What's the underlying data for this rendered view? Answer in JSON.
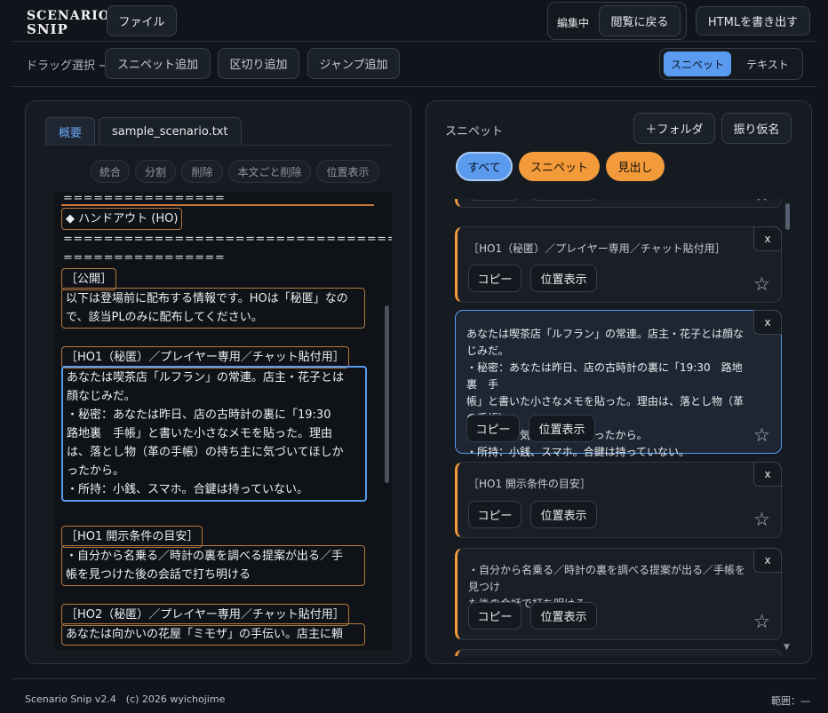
{
  "header": {
    "logo_line1": "SCENARIO",
    "logo_line2": "SNIP",
    "file_button": "ファイル",
    "mode_label": "編集中",
    "back_button": "閲覧に戻る",
    "export_button": "HTMLを書き出す"
  },
  "toolbar": {
    "drag_label": "ドラッグ選択 →",
    "add_snippet": "スニペット追加",
    "add_separator": "区切り追加",
    "add_jump": "ジャンプ追加",
    "view_snippet": "スニペット",
    "view_text": "テキスト"
  },
  "left_panel": {
    "tabs": [
      {
        "label": "概要"
      },
      {
        "label": "sample_scenario.txt"
      }
    ],
    "actions": [
      {
        "label": "統合"
      },
      {
        "label": "分割"
      },
      {
        "label": "削除"
      },
      {
        "label": "本文ごと削除"
      },
      {
        "label": "位置表示"
      }
    ],
    "editor_lines": {
      "sep1": "================",
      "handout": "◆ ハンドアウト (HO)",
      "sep2": "=========================================",
      "sep3": "================",
      "public_head": "［公開］",
      "public_body_1": "以下は登場前に配布する情報です。HOは「秘匿」なの",
      "public_body_2": "で、該当PLのみに配布してください。",
      "ho1_head": "［HO1（秘匿）／プレイヤー専用／チャット貼付用］",
      "ho1_body_1": "あなたは喫茶店「ルフラン」の常連。店主・花子とは",
      "ho1_body_2": "顔なじみだ。",
      "ho1_body_3": "・秘密：あなたは昨日、店の古時計の裏に「19:30",
      "ho1_body_4": "路地裏　手帳」と書いた小さなメモを貼った。理由",
      "ho1_body_5": "は、落とし物（革の手帳）の持ち主に気づいてほしか",
      "ho1_body_6": "ったから。",
      "ho1_body_7": "・所持：小銭、スマホ。合鍵は持っていない。",
      "ho1_cond_head": "［HO1 開示条件の目安］",
      "ho1_cond_1": "・自分から名乗る／時計の裏を調べる提案が出る／手",
      "ho1_cond_2": "帳を見つけた後の会話で打ち明ける",
      "ho2_head": "［HO2（秘匿）／プレイヤー専用／チャット貼付用］",
      "ho2_body_1": "あなたは向かいの花屋「ミモザ」の手伝い。店主に頼"
    }
  },
  "right_panel": {
    "title": "スニペット",
    "add_folder": "＋フォルダ",
    "furigana": "振り仮名",
    "filters": [
      {
        "label": "すべて"
      },
      {
        "label": "スニペット"
      },
      {
        "label": "見出し"
      }
    ],
    "copy_label": "コピー",
    "locate_label": "位置表示",
    "close_label": "x",
    "star": "☆",
    "cards": [
      {
        "lines": [
          "［HO1（秘匿）／プレイヤー専用／チャット貼付用］"
        ]
      },
      {
        "lines": [
          "あなたは喫茶店「ルフラン」の常連。店主・花子とは顔なじみだ。",
          "・秘密：あなたは昨日、店の古時計の裏に「19:30　路地裏　手",
          "帳」と書いた小さなメモを貼った。理由は、落とし物（革の手帳）",
          "の持ち主に気づいてほしかったから。",
          "・所持：小銭、スマホ。合鍵は持っていない。"
        ]
      },
      {
        "lines": [
          "［HO1 開示条件の目安］"
        ]
      },
      {
        "lines": [
          "・自分から名乗る／時計の裏を調べる提案が出る／手帳を見つけ",
          "た後の会話で打ち明ける"
        ]
      }
    ]
  },
  "footer": {
    "version": "Scenario Snip v2.4　(c) 2026 wyichojime",
    "range": "範囲：—"
  },
  "colors": {
    "accent_blue": "#5a9bf0",
    "accent_orange": "#f39a3b",
    "background": "#11151b"
  }
}
